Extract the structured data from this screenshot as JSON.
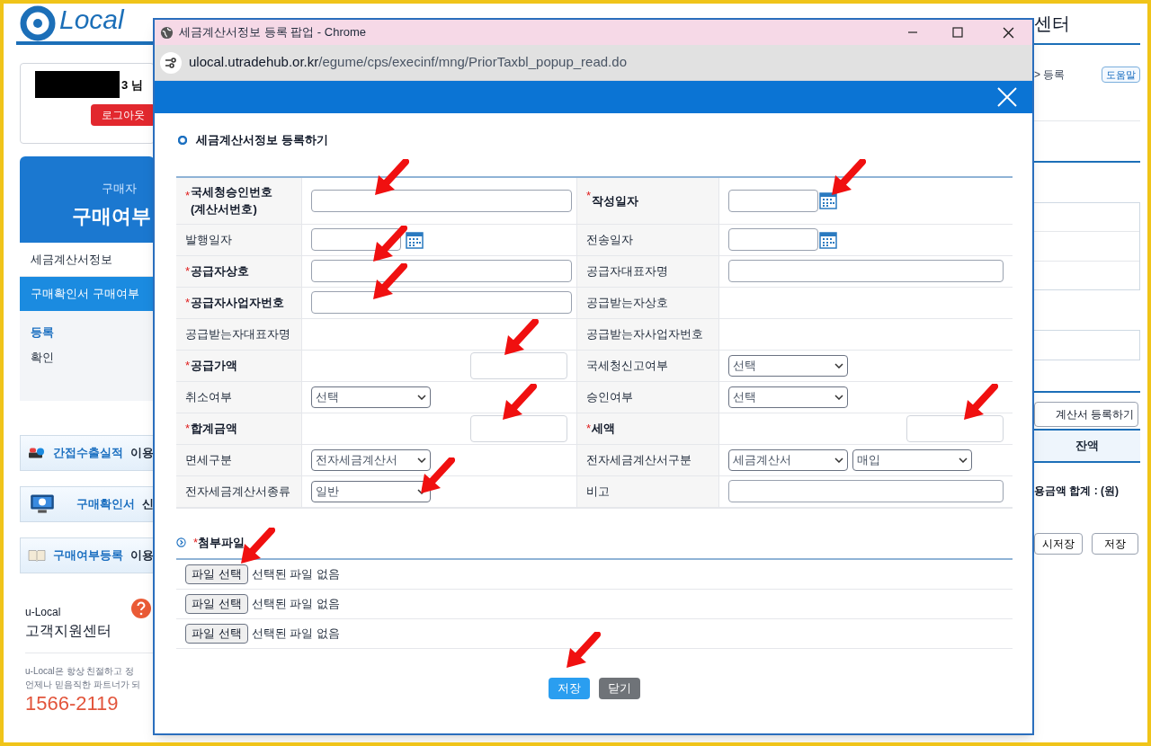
{
  "background_page": {
    "logo": "Local",
    "header_fragment": "센터",
    "user": {
      "greeting": "3 님",
      "logout": "로그아웃"
    },
    "panel": {
      "subtitle": "구매자",
      "title": "구매여부"
    },
    "menu": [
      {
        "label": "세금계산서정보",
        "selected": false
      },
      {
        "label": "구매확인서 구매여부",
        "selected": true
      }
    ],
    "submenu": [
      {
        "label": "등록",
        "selected": true
      },
      {
        "label": "확인",
        "selected": false
      }
    ],
    "banners": [
      {
        "highlight": "간접수출실적",
        "rest": "이용"
      },
      {
        "highlight": "구매확인서",
        "rest": "신"
      },
      {
        "highlight": "구매여부등록",
        "rest": "이용"
      }
    ],
    "support": {
      "brand": "u-Local",
      "title": "고객지원센터",
      "lines": [
        "u-Local은 항상 친절하고 정",
        "언제나 믿음직한 파트너가 되"
      ],
      "phone": "1566-2119"
    },
    "breadcrumb": "> 등록",
    "help": "도움말",
    "register_button": "계산서 등록하기",
    "balance_header": "잔액",
    "total_label": "용금액 합계 : (원)",
    "buttons": [
      "시저장",
      "저장"
    ]
  },
  "popup": {
    "title": "세금계산서정보 등록 팝업 - Chrome",
    "url_host": "ulocal.utradehub.or.kr",
    "url_path": "/egume/cps/execinf/mng/PriorTaxbl_popup_read.do",
    "section_title": "세금계산서정보 등록하기",
    "rows": [
      [
        {
          "label": "국세청승인번호\n(계산서번호)",
          "required": true,
          "mark": "*",
          "field": {
            "kind": "input"
          }
        },
        {
          "label": "작성일자",
          "required": true,
          "mark": "*",
          "field": {
            "kind": "date"
          }
        }
      ],
      [
        {
          "label": "발행일자",
          "required": false,
          "field": {
            "kind": "date"
          }
        },
        {
          "label": "전송일자",
          "required": false,
          "field": {
            "kind": "date"
          }
        }
      ],
      [
        {
          "label": "공급자상호",
          "required": true,
          "mark": "*",
          "field": {
            "kind": "input"
          }
        },
        {
          "label": "공급자대표자명",
          "required": false,
          "field": {
            "kind": "input"
          }
        }
      ],
      [
        {
          "label": "공급자사업자번호",
          "required": true,
          "mark": "*",
          "field": {
            "kind": "input"
          }
        },
        {
          "label": "공급받는자상호",
          "required": false,
          "field": {
            "kind": "empty"
          }
        }
      ],
      [
        {
          "label": "공급받는자대표자명",
          "required": false,
          "field": {
            "kind": "empty"
          }
        },
        {
          "label": "공급받는자사업자번호",
          "required": false,
          "field": {
            "kind": "empty"
          }
        }
      ],
      [
        {
          "label": "공급가액",
          "required": true,
          "mark": "*",
          "field": {
            "kind": "amount"
          }
        },
        {
          "label": "국세청신고여부",
          "required": false,
          "field": {
            "kind": "select",
            "value": "선택"
          }
        }
      ],
      [
        {
          "label": "취소여부",
          "required": false,
          "field": {
            "kind": "select",
            "value": "선택"
          }
        },
        {
          "label": "승인여부",
          "required": false,
          "field": {
            "kind": "select",
            "value": "선택"
          }
        }
      ],
      [
        {
          "label": "합계금액",
          "required": true,
          "mark": "*",
          "field": {
            "kind": "amount"
          }
        },
        {
          "label": "세액",
          "required": true,
          "mark": "*",
          "field": {
            "kind": "amount"
          }
        }
      ],
      [
        {
          "label": "면세구분",
          "required": false,
          "field": {
            "kind": "select",
            "value": "전자세금계산서"
          }
        },
        {
          "label": "전자세금계산서구분",
          "required": false,
          "field": {
            "kind": "select-pair",
            "values": [
              "세금계산서",
              "매입"
            ]
          }
        }
      ],
      [
        {
          "label": "전자세금계산서종류",
          "required": false,
          "field": {
            "kind": "select",
            "value": "일반"
          }
        },
        {
          "label": "비고",
          "required": false,
          "field": {
            "kind": "input"
          }
        }
      ]
    ],
    "attachments": {
      "mark": "*",
      "title": "첨부파일",
      "files": [
        {
          "button": "파일 선택",
          "status": "선택된 파일 없음"
        },
        {
          "button": "파일 선택",
          "status": "선택된 파일 없음"
        },
        {
          "button": "파일 선택",
          "status": "선택된 파일 없음"
        }
      ]
    },
    "buttons": [
      {
        "label": "저장",
        "kind": "primary"
      },
      {
        "label": "닫기",
        "kind": "secondary"
      }
    ]
  }
}
